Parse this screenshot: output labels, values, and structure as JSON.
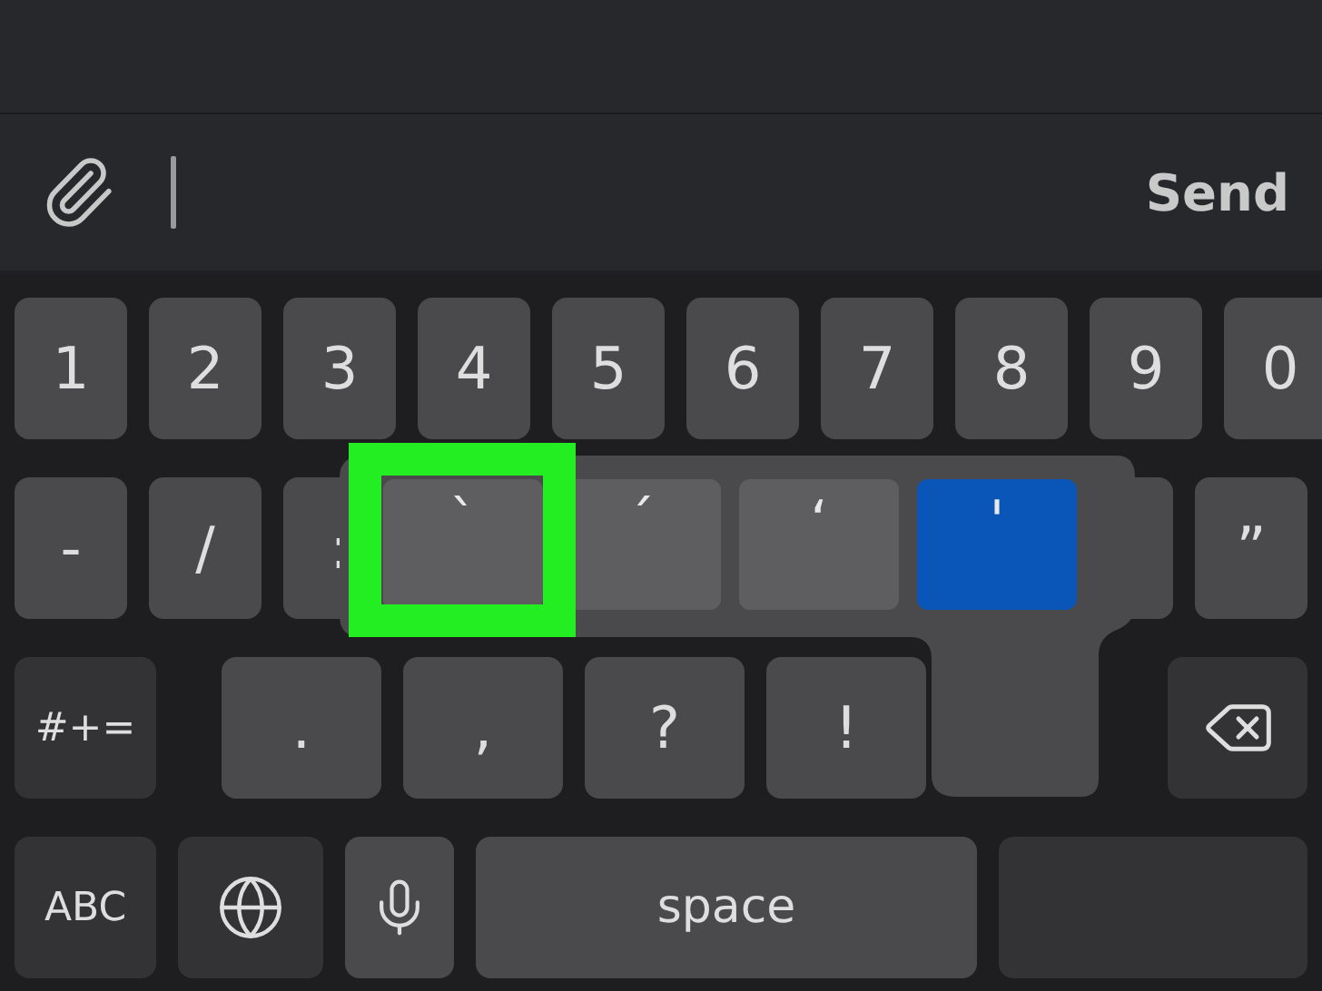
{
  "composer": {
    "send_label": "Send"
  },
  "keyboard": {
    "rows": [
      [
        {
          "kind": "key",
          "label": "1"
        },
        {
          "kind": "key",
          "label": "2"
        },
        {
          "kind": "key",
          "label": "3"
        },
        {
          "kind": "key",
          "label": "4"
        },
        {
          "kind": "key",
          "label": "5"
        },
        {
          "kind": "key",
          "label": "6"
        },
        {
          "kind": "key",
          "label": "7"
        },
        {
          "kind": "key",
          "label": "8"
        },
        {
          "kind": "key",
          "label": "9"
        },
        {
          "kind": "key",
          "label": "0"
        }
      ],
      [
        {
          "kind": "key",
          "label": "-"
        },
        {
          "kind": "key",
          "label": "/"
        },
        {
          "kind": "key",
          "label": ":"
        },
        {
          "kind": "covered"
        },
        {
          "kind": "key",
          "label": "”"
        }
      ],
      [
        {
          "kind": "mode",
          "label": "#+="
        },
        {
          "kind": "punct",
          "label": "."
        },
        {
          "kind": "punct",
          "label": ","
        },
        {
          "kind": "punct",
          "label": "?"
        },
        {
          "kind": "punct",
          "label": "!"
        },
        {
          "kind": "backspace"
        }
      ],
      [
        {
          "kind": "mode",
          "label": "ABC"
        },
        {
          "kind": "globe"
        },
        {
          "kind": "mic"
        },
        {
          "kind": "space",
          "label": "space"
        },
        {
          "kind": "return"
        }
      ]
    ],
    "popup": {
      "options": [
        {
          "label": "`",
          "selected": false,
          "highlighted": true
        },
        {
          "label": "´",
          "selected": false,
          "highlighted": false
        },
        {
          "label": "‘",
          "selected": false,
          "highlighted": false
        },
        {
          "label": "'",
          "selected": true,
          "highlighted": false
        }
      ]
    }
  }
}
